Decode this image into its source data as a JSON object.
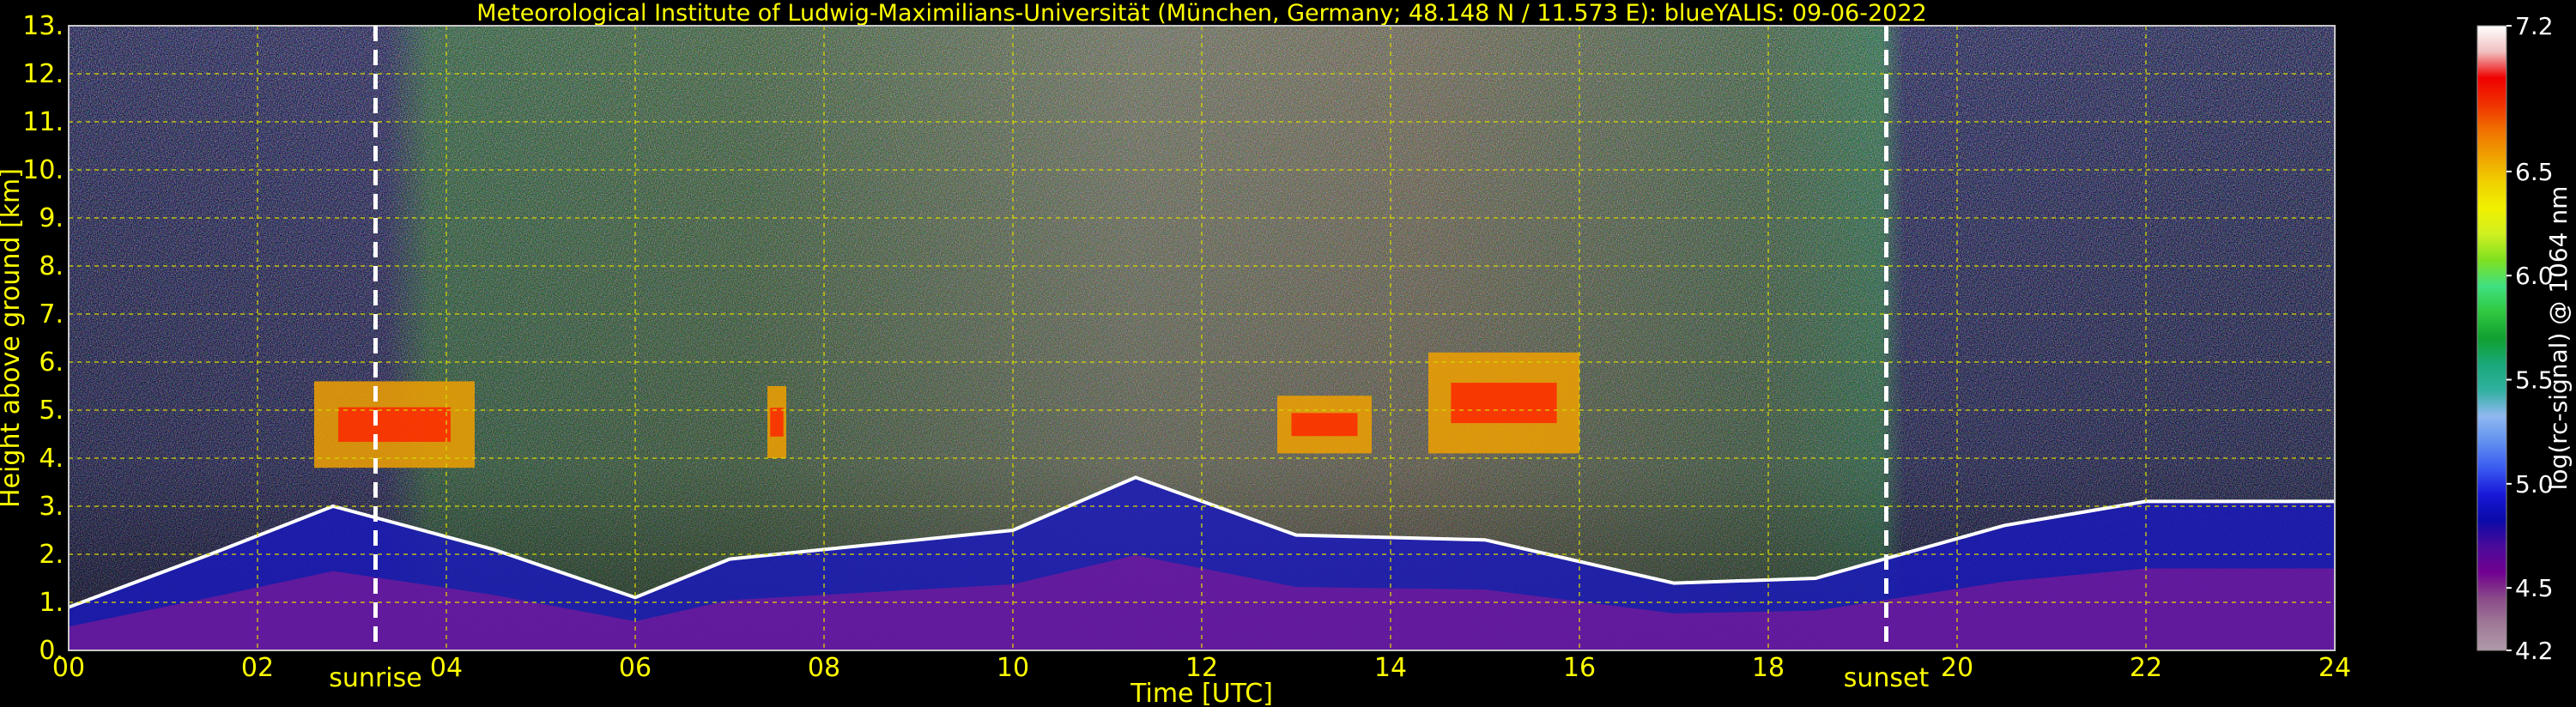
{
  "chart_data": {
    "type": "heatmap",
    "title": "Meteorological Institute of Ludwig-Maximilians-Universität (München, Germany; 48.148 N / 11.573 E):    blueYALIS: 09-06-2022",
    "xlabel": "Time [UTC]",
    "ylabel": "Height above ground [km]",
    "xlim": [
      0,
      24
    ],
    "ylim": [
      0,
      13
    ],
    "x_ticks": [
      "00",
      "02",
      "04",
      "06",
      "08",
      "10",
      "12",
      "14",
      "16",
      "18",
      "20",
      "22",
      "24"
    ],
    "y_ticks": [
      "0.",
      "1.",
      "2.",
      "3.",
      "4.",
      "5.",
      "6.",
      "7.",
      "8.",
      "9.",
      "10.",
      "11.",
      "12.",
      "13."
    ],
    "grid": true,
    "events": [
      {
        "label": "sunrise",
        "x": 3.25
      },
      {
        "label": "sunset",
        "x": 19.25
      }
    ],
    "colorbar": {
      "label": "log(rc-signal) @ 1064 nm",
      "range": [
        4.2,
        7.2
      ],
      "ticks": [
        "7.2",
        "6.5",
        "6.0",
        "5.5",
        "5.0",
        "4.5",
        "4.2"
      ],
      "tick_values": [
        7.2,
        6.5,
        6.0,
        5.5,
        5.0,
        4.5,
        4.2
      ],
      "colors": [
        "#b09aa8",
        "#a07a98",
        "#8a4a88",
        "#700090",
        "#4a0a9a",
        "#0a0aa8",
        "#1818d8",
        "#3a5af0",
        "#6090f0",
        "#90b8f0",
        "#30b0a0",
        "#18a878",
        "#10a030",
        "#30c840",
        "#40e080",
        "#80e020",
        "#d0f020",
        "#f0f000",
        "#f0d000",
        "#f0a000",
        "#f07000",
        "#f03000",
        "#f00000",
        "#f0c0c0",
        "#ffffff"
      ]
    },
    "boundary_layer_top_km": [
      {
        "t": 0.0,
        "h": 0.9
      },
      {
        "t": 1.5,
        "h": 2.0
      },
      {
        "t": 2.8,
        "h": 3.0
      },
      {
        "t": 4.5,
        "h": 2.1
      },
      {
        "t": 6.0,
        "h": 1.1
      },
      {
        "t": 7.0,
        "h": 1.9
      },
      {
        "t": 10.0,
        "h": 2.5
      },
      {
        "t": 11.3,
        "h": 3.6
      },
      {
        "t": 13.0,
        "h": 2.4
      },
      {
        "t": 15.0,
        "h": 2.3
      },
      {
        "t": 17.0,
        "h": 1.4
      },
      {
        "t": 18.5,
        "h": 1.5
      },
      {
        "t": 20.5,
        "h": 2.6
      },
      {
        "t": 22.0,
        "h": 3.1
      },
      {
        "t": 24.0,
        "h": 3.1
      }
    ],
    "cloud_layers": [
      {
        "t0": 2.6,
        "t1": 4.3,
        "h0": 3.8,
        "h1": 5.6
      },
      {
        "t0": 7.4,
        "t1": 7.6,
        "h0": 4.0,
        "h1": 5.5
      },
      {
        "t0": 12.8,
        "t1": 13.8,
        "h0": 4.1,
        "h1": 5.3
      },
      {
        "t0": 14.4,
        "t1": 16.0,
        "h0": 4.1,
        "h1": 6.2
      }
    ]
  }
}
